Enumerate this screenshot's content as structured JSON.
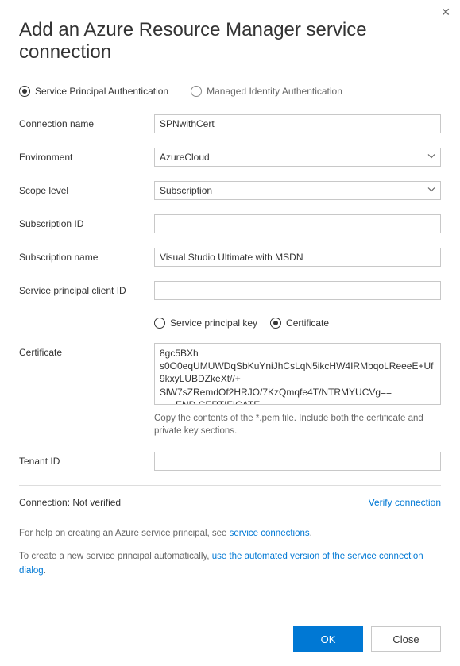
{
  "dialog": {
    "title": "Add an Azure Resource Manager service connection"
  },
  "authmode": {
    "spa_label": "Service Principal Authentication",
    "mia_label": "Managed Identity Authentication",
    "selected": "spa"
  },
  "fields": {
    "connection_name": {
      "label": "Connection name",
      "value": "SPNwithCert"
    },
    "environment": {
      "label": "Environment",
      "value": "AzureCloud"
    },
    "scope_level": {
      "label": "Scope level",
      "value": "Subscription"
    },
    "subscription_id": {
      "label": "Subscription ID",
      "value": ""
    },
    "subscription_name": {
      "label": "Subscription name",
      "value": "Visual Studio Ultimate with MSDN"
    },
    "sp_client_id": {
      "label": "Service principal client ID",
      "value": ""
    },
    "cred_type": {
      "key_label": "Service principal key",
      "cert_label": "Certificate",
      "selected": "cert"
    },
    "certificate": {
      "label": "Certificate",
      "value": "8gc5BXh\ns0O0eqUMUWDqSbKuYniJhCsLqN5ikcHW4IRMbqoLReeeE+Uf9kxyLUBDZkeXt//+\nSlW7sZRemdOf2HRJO/7KzQmqfe4T/NTRMYUCVg==\n-----END CERTIFICATE-----",
      "help": "Copy the contents of the *.pem file. Include both the certificate and private key sections."
    },
    "tenant_id": {
      "label": "Tenant ID",
      "value": ""
    }
  },
  "status": {
    "label": "Connection:",
    "value": "Not verified",
    "verify_link": "Verify connection"
  },
  "help": {
    "p1_prefix": "For help on creating an Azure service principal, see ",
    "p1_link": "service connections",
    "p1_suffix": ".",
    "p2_prefix": "To create a new service principal automatically, ",
    "p2_link": "use the automated version of the service connection dialog",
    "p2_suffix": "."
  },
  "buttons": {
    "ok": "OK",
    "close": "Close"
  }
}
